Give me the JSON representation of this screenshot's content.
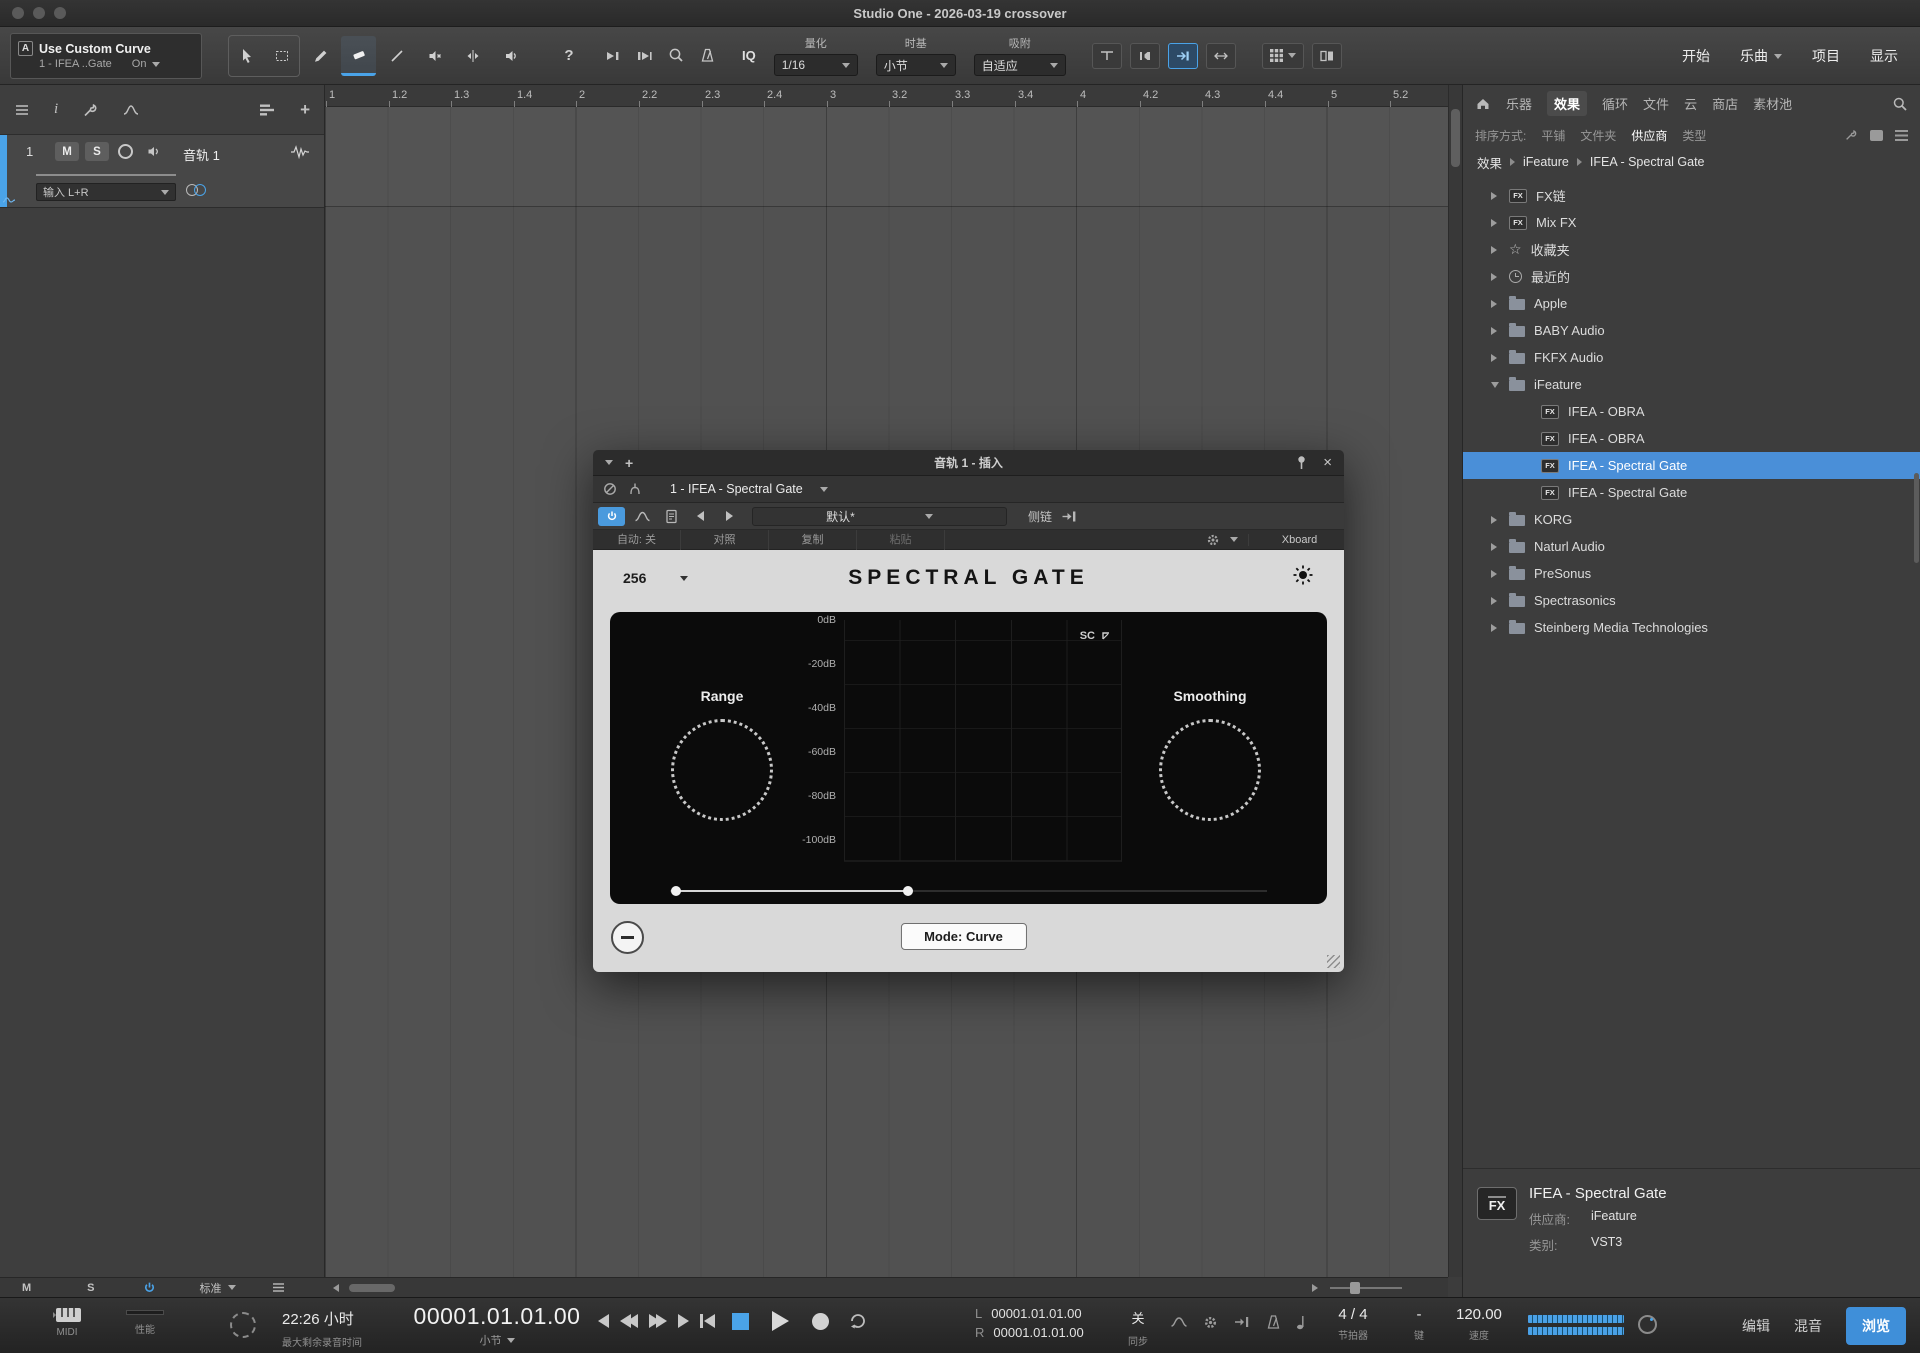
{
  "window": {
    "title": "Studio One - 2026-03-19 crossover"
  },
  "toolbar": {
    "macro": {
      "line1": "Use Custom Curve",
      "line2": "1 - IFEA ..Gate",
      "state": "On"
    },
    "help": "?",
    "iq": "IQ",
    "quantize_label": "量化",
    "quantize_value": "1/16",
    "timebase_label": "时基",
    "timebase_value": "小节",
    "snap_label": "吸附",
    "snap_value": "自适应",
    "btn_start": "开始",
    "btn_song": "乐曲",
    "btn_project": "项目",
    "btn_show": "显示"
  },
  "timeline": {
    "ticks": [
      "1",
      "1.2",
      "1.3",
      "1.4",
      "2",
      "2.2",
      "2.3",
      "2.4",
      "3",
      "3.2",
      "3.3",
      "3.4",
      "4",
      "4.2",
      "4.3",
      "4.4",
      "5",
      "5.2"
    ]
  },
  "track": {
    "number": "1",
    "mute": "M",
    "solo": "S",
    "name": "音轨 1",
    "input": "输入 L+R",
    "bottom_mute": "M",
    "bottom_solo": "S",
    "bottom_mode": "标准"
  },
  "plugin": {
    "header_title": "音轨 1 - 插入",
    "slot_name": "1 - IFEA - Spectral Gate",
    "preset": "默认*",
    "listen": "侧链",
    "auto": "自动: 关",
    "compare": "对照",
    "copy": "复制",
    "paste": "粘贴",
    "xboard": "Xboard",
    "fft": "256",
    "title": "SPECTRAL GATE",
    "sc": "SC",
    "db_labels": [
      "0dB",
      "-20dB",
      "-40dB",
      "-60dB",
      "-80dB",
      "-100dB"
    ],
    "range": "Range",
    "smoothing": "Smoothing",
    "mode": "Mode: Curve"
  },
  "browser": {
    "tabs": [
      "乐器",
      "效果",
      "循环",
      "文件",
      "云",
      "商店",
      "素材池"
    ],
    "sort_label": "排序方式:",
    "sort_options": [
      "平铺",
      "文件夹",
      "供应商",
      "类型"
    ],
    "breadcrumb": [
      "效果",
      "iFeature",
      "IFEA - Spectral Gate"
    ],
    "tree": [
      {
        "label": "FX链",
        "icon": "fx-chain"
      },
      {
        "label": "Mix FX",
        "icon": "mix-fx"
      },
      {
        "label": "收藏夹",
        "icon": "star"
      },
      {
        "label": "最近的",
        "icon": "clock"
      },
      {
        "label": "Apple",
        "icon": "folder"
      },
      {
        "label": "BABY Audio",
        "icon": "folder"
      },
      {
        "label": "FKFX Audio",
        "icon": "folder"
      },
      {
        "label": "iFeature",
        "icon": "folder-open"
      },
      {
        "label": "IFEA - OBRA",
        "icon": "fx-plugin"
      },
      {
        "label": "IFEA - OBRA",
        "icon": "fx-plugin"
      },
      {
        "label": "IFEA - Spectral Gate",
        "icon": "fx-plugin",
        "selected": true
      },
      {
        "label": "IFEA - Spectral Gate",
        "icon": "fx-plugin"
      },
      {
        "label": "KORG",
        "icon": "folder"
      },
      {
        "label": "Naturl Audio",
        "icon": "folder"
      },
      {
        "label": "PreSonus",
        "icon": "folder"
      },
      {
        "label": "Spectrasonics",
        "icon": "folder"
      },
      {
        "label": "Steinberg Media Technologies",
        "icon": "folder"
      }
    ],
    "info_name": "IFEA - Spectral Gate",
    "info_vendor_label": "供应商:",
    "info_vendor": "iFeature",
    "info_category_label": "类别:",
    "info_category": "VST3"
  },
  "transport": {
    "midi": "MIDI",
    "perf": "性能",
    "remaining_time": "22:26 小时",
    "remaining_label": "最大剩余录音时间",
    "position": "00001.01.01.00",
    "position_unit": "小节",
    "loop_l_label": "L",
    "loop_l": "00001.01.01.00",
    "loop_r_label": "R",
    "loop_r": "00001.01.01.00",
    "sync_value": "关",
    "sync_label": "同步",
    "timesig": "4 / 4",
    "timesig_label": "节拍器",
    "key_value": "-",
    "key_label": "键",
    "tempo": "120.00",
    "tempo_label": "速度",
    "btn_edit": "编辑",
    "btn_mix": "混音",
    "btn_browse": "浏览"
  }
}
